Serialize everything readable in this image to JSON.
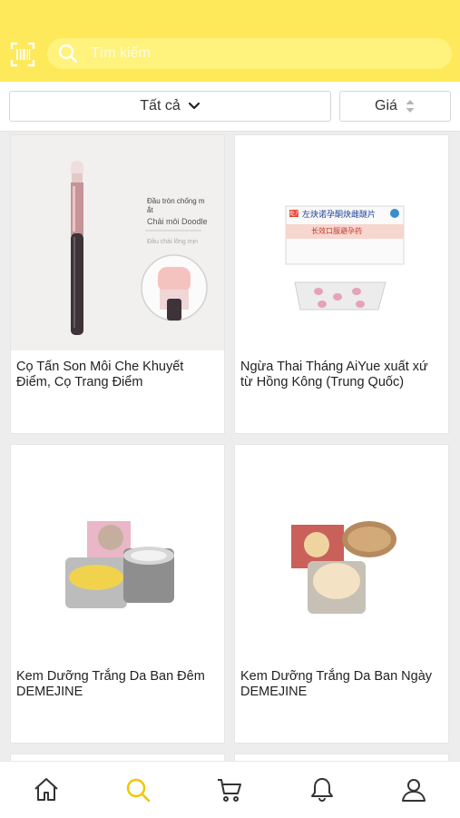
{
  "header": {
    "barcode_icon": "barcode-scan-icon",
    "search": {
      "placeholder": "Tìm kiếm",
      "value": "",
      "icon": "search-icon"
    }
  },
  "filters": {
    "category_label": "Tất cả",
    "category_icon": "chevron-down-icon",
    "price_label": "Giá",
    "price_icon": "sort-updown-icon"
  },
  "products": [
    {
      "name": "Cọ Tấn Son Môi Che Khuyết Điểm, Cọ Trang Điểm",
      "image_text": {
        "line1": "Đầu tròn chống m",
        "line2": "ắt",
        "line3": "Chải môi Doodle"
      }
    },
    {
      "name": "Ngừa Thai Tháng AiYue xuất xứ từ Hồng Kông (Trung Quốc)",
      "image_text": {
        "box_top": "左炔诺孕酮炔雌醚片",
        "box_band": "长效口服避孕药",
        "box_tag": "处方"
      }
    },
    {
      "name": "Kem Dưỡng Trắng Da Ban Đêm DEMEJINE"
    },
    {
      "name": "Kem Dưỡng Trắng Da Ban Ngày DEMEJINE"
    }
  ],
  "bottom_nav": [
    {
      "icon": "home-icon"
    },
    {
      "icon": "search-icon",
      "active": true
    },
    {
      "icon": "cart-icon"
    },
    {
      "icon": "bell-icon"
    },
    {
      "icon": "profile-icon"
    }
  ],
  "colors": {
    "header": "#fee95a",
    "search_bg": "#fff27d",
    "accent": "#f2c500",
    "icon": "#333333"
  }
}
